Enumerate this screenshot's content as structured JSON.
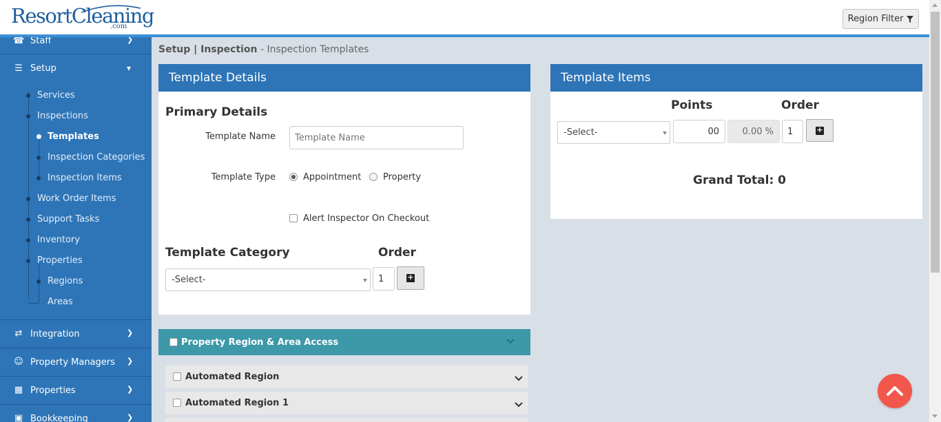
{
  "brand": {
    "name": "ResortCleaning",
    "suffix": ".com"
  },
  "header": {
    "region_filter_label": "Region Filter"
  },
  "sidebar": {
    "staff_label": "Staff",
    "setup_label": "Setup",
    "setup_children": {
      "services": "Services",
      "inspections": "Inspections",
      "templates": "Templates",
      "inspection_categories": "Inspection Categories",
      "inspection_items": "Inspection Items",
      "work_order_items": "Work Order Items",
      "support_tasks": "Support Tasks",
      "inventory": "Inventory",
      "properties": "Properties",
      "regions": "Regions",
      "areas": "Areas"
    },
    "integration_label": "Integration",
    "property_managers_label": "Property Managers",
    "properties_label": "Properties",
    "bookkeeping_label": "Bookkeeping"
  },
  "breadcrumb": {
    "section": "Setup | Inspection",
    "page": " - Inspection Templates"
  },
  "template_details": {
    "title": "Template Details",
    "primary_heading": "Primary Details",
    "name_label": "Template Name",
    "name_placeholder": "Template Name",
    "type_label": "Template Type",
    "type_options": {
      "appointment": "Appointment",
      "property": "Property"
    },
    "alert_label": "Alert Inspector On Checkout",
    "category_heading": "Template Category",
    "order_heading": "Order",
    "category_select": "-Select-",
    "order_value": "1"
  },
  "region_access": {
    "title": "Property Region & Area Access",
    "rows": {
      "r1": "Automated Region",
      "r2": "Automated Region 1"
    }
  },
  "template_items": {
    "title": "Template Items",
    "points_heading": "Points",
    "order_heading": "Order",
    "item_select": "-Select-",
    "points_value": "00",
    "percent_value": "0.00 %",
    "order_value": "1",
    "grand_total": "Grand Total: 0"
  },
  "colors": {
    "primary": "#2e75b7",
    "teal": "#3d98a8",
    "fab": "#f2574b"
  }
}
